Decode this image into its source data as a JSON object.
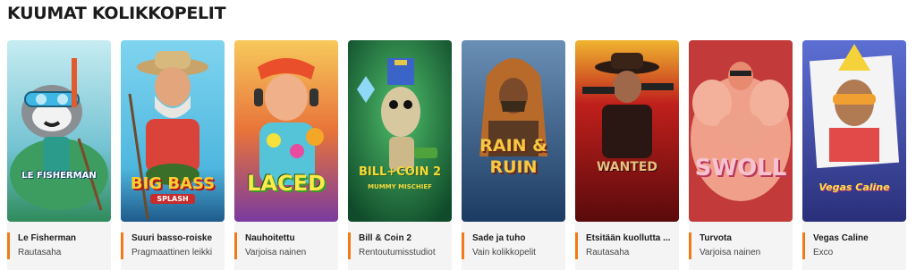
{
  "section": {
    "title": "KUUMAT KOLIKKOPELIT"
  },
  "games": [
    {
      "name": "Le Fisherman",
      "provider": "Rautasaha",
      "logo": "LE FISHERMAN",
      "bg": "#7fc7d6",
      "accent_color": "#f07a16"
    },
    {
      "name": "Suuri basso-roiske",
      "provider": "Pragmaattinen leikki",
      "logo": "BIG BASS",
      "logo_sub": "SPLASH",
      "bg": "#62c6e6",
      "accent_color": "#f07a16"
    },
    {
      "name": "Nauhoitettu",
      "provider": "Varjoisa nainen",
      "logo": "LACED",
      "bg": "#f3a63f",
      "accent_color": "#f07a16"
    },
    {
      "name": "Bill & Coin 2",
      "provider": "Rentoutumisstudiot",
      "logo": "BILL+COIN 2",
      "logo_sub": "MUMMY MISCHIEF",
      "bg": "#1d6a3c",
      "accent_color": "#f07a16"
    },
    {
      "name": "Sade ja tuho",
      "provider": "Vain kolikkopelit",
      "logo": "RAIN & RUIN",
      "bg": "#2a4f7a",
      "accent_color": "#f07a16"
    },
    {
      "name": "Etsitään kuollutta ...",
      "provider": "Rautasaha",
      "logo": "WANTED",
      "bg": "#b3161e",
      "accent_color": "#f07a16"
    },
    {
      "name": "Turvota",
      "provider": "Varjoisa nainen",
      "logo": "SWOLL",
      "bg": "#e9716f",
      "accent_color": "#f07a16"
    },
    {
      "name": "Vegas Caline",
      "provider": "Exco",
      "logo": "Vegas Caline",
      "bg": "#6e6fd1",
      "accent_color": "#f07a16"
    }
  ]
}
